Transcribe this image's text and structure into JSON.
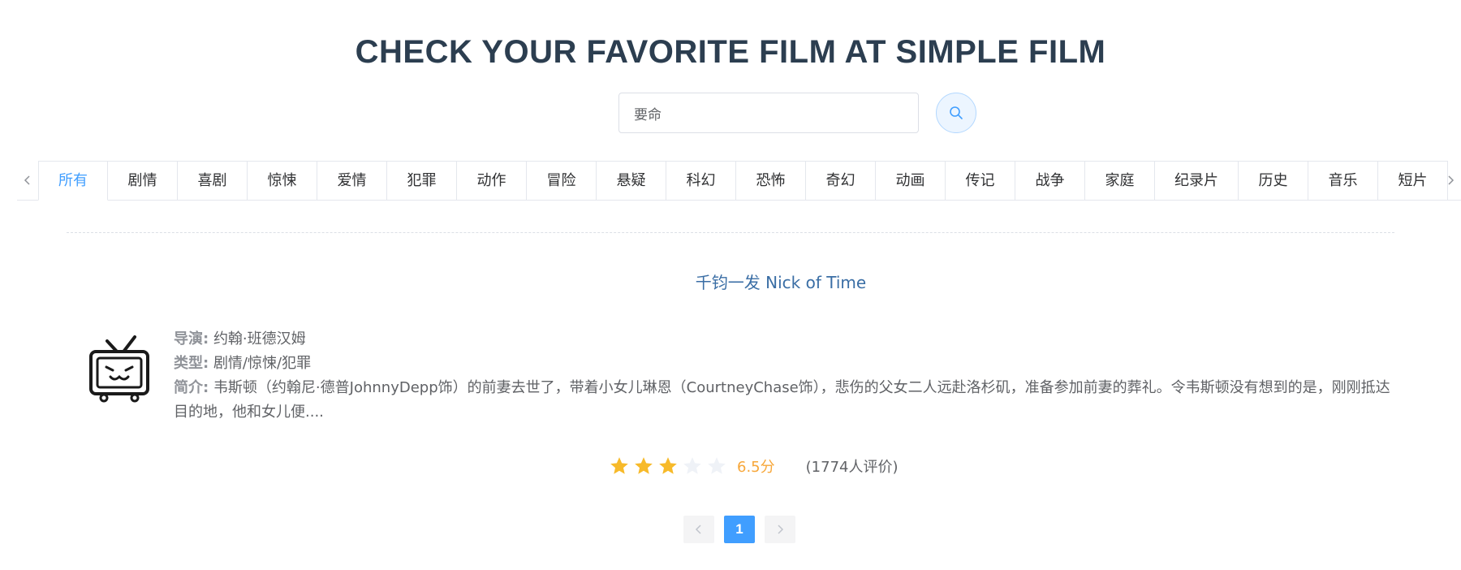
{
  "page": {
    "title": "CHECK YOUR FAVORITE FILM AT SIMPLE FILM"
  },
  "search": {
    "value": "要命",
    "button_icon": "search-icon"
  },
  "tabs": {
    "active_index": 0,
    "prev_icon": "chevron-left-icon",
    "next_icon": "chevron-right-icon",
    "items": [
      "所有",
      "剧情",
      "喜剧",
      "惊悚",
      "爱情",
      "犯罪",
      "动作",
      "冒险",
      "悬疑",
      "科幻",
      "恐怖",
      "奇幻",
      "动画",
      "传记",
      "战争",
      "家庭",
      "纪录片",
      "历史",
      "音乐",
      "短片"
    ]
  },
  "film": {
    "title": "千钧一发 Nick of Time",
    "poster_icon": "tv-mascot-icon",
    "director_label": "导演:",
    "director": "约翰·班德汉姆",
    "genre_label": "类型:",
    "genre": "剧情/惊悚/犯罪",
    "summary_label": "简介:",
    "summary": "韦斯顿（约翰尼·德普JohnnyDepp饰）的前妻去世了，带着小女儿琳恩（CourtneyChase饰），悲伤的父女二人远赴洛杉矶，准备参加前妻的葬礼。令韦斯顿没有想到的是，刚刚抵达目的地，他和女儿便....",
    "rating_stars": 3,
    "rating_max": 5,
    "score_text": "6.5分",
    "count_text": "(1774人评价)"
  },
  "pagination": {
    "current": "1",
    "prev_icon": "chevron-left-icon",
    "next_icon": "chevron-right-icon"
  },
  "colors": {
    "accent": "#409eff",
    "title": "#2c3e50",
    "star_on": "#f7ba2a",
    "star_off": "#eff2f7",
    "score": "#f7a73a"
  }
}
